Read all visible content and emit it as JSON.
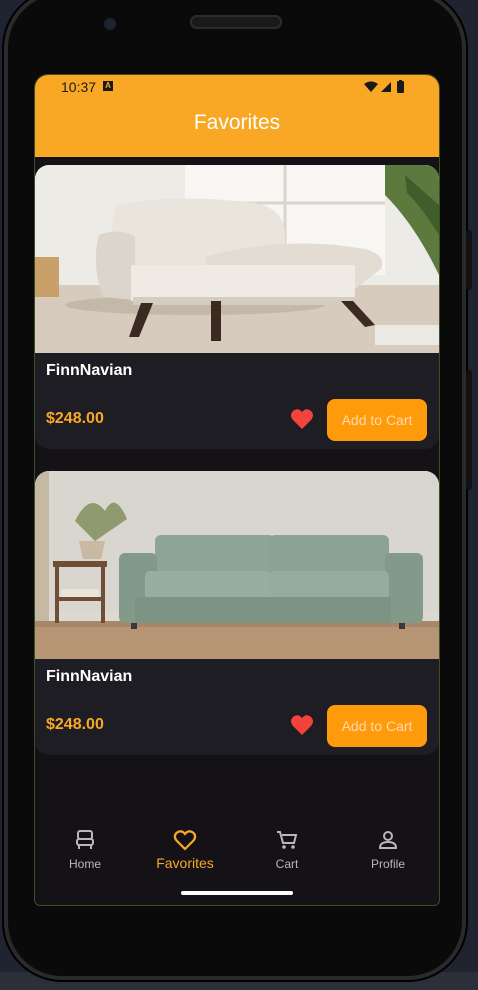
{
  "status_bar": {
    "time": "10:37",
    "notification_badge": "A"
  },
  "app_bar": {
    "title": "Favorites"
  },
  "favorites": [
    {
      "name": "FinnNavian",
      "price": "$248.00",
      "button_label": "Add to Cart",
      "image": "armchair-photo"
    },
    {
      "name": "FinnNavian",
      "price": "$248.00",
      "button_label": "Add to Cart",
      "image": "sofa-photo"
    }
  ],
  "bottom_nav": {
    "items": [
      {
        "label": "Home",
        "icon": "home-icon"
      },
      {
        "label": "Favorites",
        "icon": "heart-outline-icon"
      },
      {
        "label": "Cart",
        "icon": "cart-icon"
      },
      {
        "label": "Profile",
        "icon": "person-icon"
      }
    ],
    "active": "Favorites"
  },
  "colors": {
    "accent": "#f9a825",
    "button": "#ff9a0a",
    "heart": "#f4433a",
    "background": "#141217",
    "card": "#1f1d24"
  }
}
